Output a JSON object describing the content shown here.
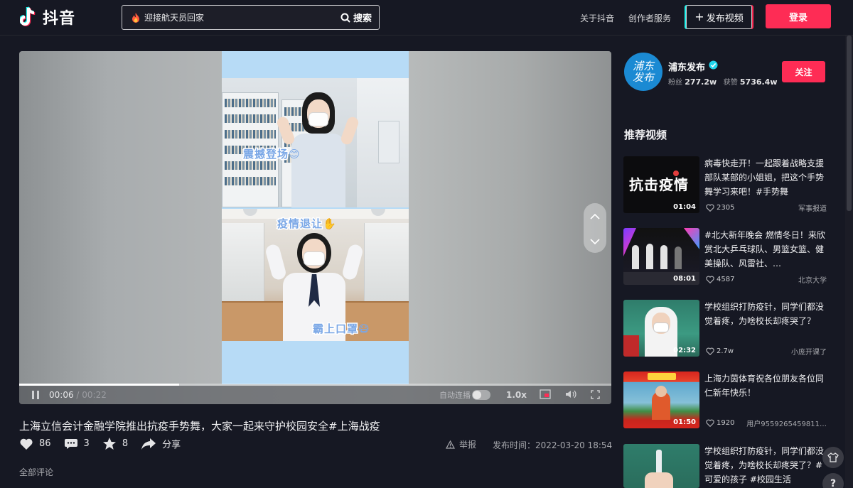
{
  "app": {
    "name": "抖音"
  },
  "search": {
    "value": "迎接航天员回家",
    "button_label": "搜索"
  },
  "nav": {
    "about": "关于抖音",
    "creator": "创作者服务",
    "publish": "发布视频",
    "login": "登录"
  },
  "player": {
    "current_time": "00:06",
    "separator": " / ",
    "duration": "00:22",
    "progress": 0.27,
    "autoplay_label": "自动连播",
    "autoplay_on": false,
    "speed": "1.0x",
    "stickers": {
      "top": "震撼登场",
      "middle": "疫情退让",
      "bottom": "霸上口罩"
    }
  },
  "video": {
    "title": "上海立信会计金融学院推出抗疫手势舞，大家一起来守护校园安全#上海战疫",
    "likes": "86",
    "comments": "3",
    "favorites": "8",
    "share_label": "分享",
    "report_label": "举报",
    "publish_time": "发布时间：2022-03-20 18:54"
  },
  "comments": {
    "label": "全部评论"
  },
  "author": {
    "name": "浦东发布",
    "avatar_text": "浦东发布",
    "fans_label": "粉丝",
    "fans": "277.2w",
    "likes_label": "获赞",
    "likes": "5736.4w",
    "follow_label": "关注"
  },
  "recommend": {
    "title": "推荐视频",
    "items": [
      {
        "desc": "病毒快走开！一起跟着战略支援部队某部的小姐姐，把这个手势舞学习来吧！#手势舞",
        "duration": "01:04",
        "likes": "2305",
        "author": "军事报道",
        "thumb_text": "抗击疫情"
      },
      {
        "desc": "#北大新年晚会 燃情冬日！来欣赏北大乒乓球队、男篮女篮、健美操队、风雷社、…",
        "duration": "08:01",
        "likes": "4587",
        "author": "北京大学",
        "thumb_text": ""
      },
      {
        "desc": "学校组织打防疫针，同学们都没觉着疼，为啥校长却疼哭了？",
        "duration": "02:32",
        "likes": "2.7w",
        "author": "小庞开课了",
        "thumb_text": ""
      },
      {
        "desc": "上海力茵体育祝各位朋友各位同仁新年快乐！",
        "duration": "01:50",
        "likes": "1920",
        "author": "用户9559265459811…",
        "thumb_text": ""
      },
      {
        "desc": "学校组织打防疫针，同学们都没觉着疼，为啥校长却疼哭了？#可爱的孩子 #校园生活",
        "duration": "",
        "likes": "",
        "author": "",
        "thumb_text": ""
      }
    ]
  },
  "colors": {
    "bg": "#161823",
    "accent": "#fe2c55",
    "verified": "#20d5ec"
  }
}
